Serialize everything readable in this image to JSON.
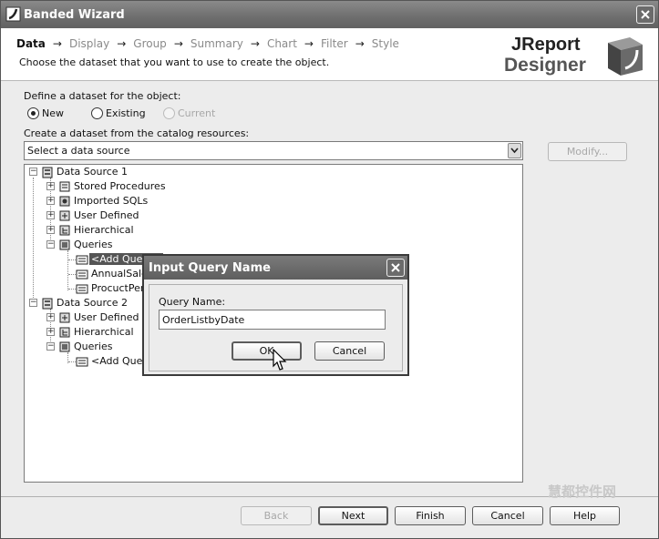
{
  "window": {
    "title": "Banded Wizard",
    "app_icon": "jreport-icon",
    "close_icon": "close-icon"
  },
  "header": {
    "steps": [
      "Data",
      "Display",
      "Group",
      "Summary",
      "Chart",
      "Filter",
      "Style"
    ],
    "active_step": "Data",
    "arrow": "→",
    "subtitle": "Choose the dataset that you want to use to create the object.",
    "logo": {
      "line1": "JReport",
      "line2": "Designer"
    }
  },
  "dataset": {
    "define_label": "Define a dataset for the object:",
    "options": [
      {
        "label": "New",
        "selected": true,
        "enabled": true
      },
      {
        "label": "Existing",
        "selected": false,
        "enabled": true
      },
      {
        "label": "Current",
        "selected": false,
        "enabled": false
      }
    ],
    "catalog_label": "Create a dataset from the catalog resources:",
    "source_select": {
      "value": "Select a data source"
    },
    "modify_button": "Modify..."
  },
  "tree": {
    "nodes": [
      {
        "label": "Data Source 1",
        "icon": "data-source-icon",
        "expander": "−"
      },
      {
        "label": "Stored Procedures",
        "icon": "stored-procedures-icon",
        "expander": "+"
      },
      {
        "label": "Imported SQLs",
        "icon": "imported-sqls-icon",
        "expander": "+"
      },
      {
        "label": "User Defined",
        "icon": "user-defined-icon",
        "expander": "+"
      },
      {
        "label": "Hierarchical",
        "icon": "hierarchical-icon",
        "expander": "+"
      },
      {
        "label": "Queries",
        "icon": "queries-icon",
        "expander": "−"
      },
      {
        "label": "<Add Query>",
        "icon": "add-query-icon",
        "selected": true
      },
      {
        "label": "AnnualSales",
        "icon": "query-icon"
      },
      {
        "label": "ProcuctPerformance",
        "icon": "query-icon"
      },
      {
        "label": "Data Source 2",
        "icon": "data-source-icon",
        "expander": "−"
      },
      {
        "label": "User Defined",
        "icon": "user-defined-icon",
        "expander": "+"
      },
      {
        "label": "Hierarchical",
        "icon": "hierarchical-icon",
        "expander": "+"
      },
      {
        "label": "Queries",
        "icon": "queries-icon",
        "expander": "−"
      },
      {
        "label": "<Add Query>",
        "icon": "add-query-icon"
      }
    ]
  },
  "dialog": {
    "title": "Input Query Name",
    "field_label": "Query Name:",
    "field_value": "OrderListbyDate",
    "ok": "OK",
    "cancel": "Cancel"
  },
  "footer": {
    "back": "Back",
    "next": "Next",
    "finish": "Finish",
    "cancel": "Cancel",
    "help": "Help"
  },
  "watermark": "慧都控件网"
}
